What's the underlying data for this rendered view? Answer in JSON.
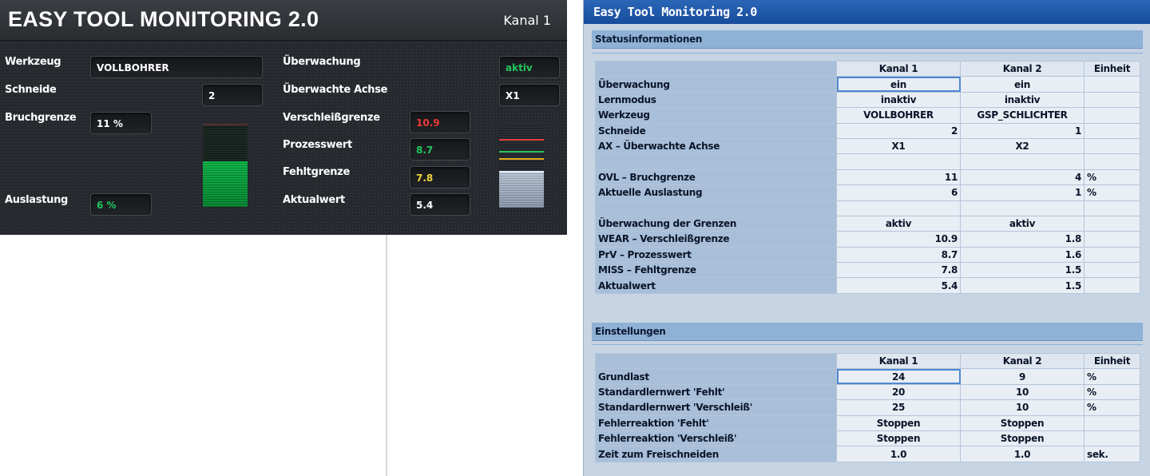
{
  "left_panel": {
    "title": "EASY TOOL MONITORING 2.0",
    "channel": "Kanal 1",
    "labels": {
      "werkzeug": "Werkzeug",
      "schneide": "Schneide",
      "bruchgrenze": "Bruchgrenze",
      "auslastung": "Auslastung",
      "ueberwachung": "Überwachung",
      "ueberwachte_achse": "Überwachte Achse",
      "verschleissgrenze": "Verschleißgrenze",
      "prozesswert": "Prozesswert",
      "fehltgrenze": "Fehltgrenze",
      "aktualwert": "Aktualwert"
    },
    "values": {
      "werkzeug": "VOLLBOHRER",
      "schneide": "2",
      "bruchgrenze": "11 %",
      "auslastung": "6 %",
      "ueberwachung": "aktiv",
      "ueberwachte_achse": "X1",
      "verschleissgrenze": "10.9",
      "prozesswert": "8.7",
      "fehltgrenze": "7.8",
      "aktualwert": "5.4"
    },
    "load_gauge": {
      "fill_fraction": 0.55,
      "color": "#0fb84a"
    },
    "limit_gauge": {
      "lines": [
        {
          "name": "verschleissgrenze",
          "color": "#e23a3a"
        },
        {
          "name": "prozesswert",
          "color": "#2fbf5a"
        },
        {
          "name": "fehltgrenze",
          "color": "#e2b020"
        },
        {
          "name": "aktualwert",
          "color": "#e6eef8"
        }
      ]
    },
    "colors": {
      "active": "#22c55e",
      "wear": "#f03a3a",
      "miss": "#f2d43a"
    }
  },
  "right_window": {
    "title": "Easy Tool Monitoring 2.0",
    "status_section": {
      "title": "Statusinformationen",
      "headers": [
        "",
        "Kanal 1",
        "Kanal 2",
        "Einheit"
      ],
      "rows": [
        [
          "Überwachung",
          "ein",
          "ein",
          ""
        ],
        [
          "Lernmodus",
          "inaktiv",
          "inaktiv",
          ""
        ],
        [
          "Werkzeug",
          "VOLLBOHRER",
          "GSP_SCHLICHTER",
          ""
        ],
        [
          "Schneide",
          "2",
          "1",
          ""
        ],
        [
          "AX – Überwachte Achse",
          "X1",
          "X2",
          ""
        ],
        [
          "",
          "",
          "",
          ""
        ],
        [
          "OVL – Bruchgrenze",
          "11",
          "4",
          "%"
        ],
        [
          "Aktuelle Auslastung",
          "6",
          "1",
          "%"
        ],
        [
          "",
          "",
          "",
          ""
        ],
        [
          "Überwachung der Grenzen",
          "aktiv",
          "aktiv",
          ""
        ],
        [
          "WEAR – Verschleißgrenze",
          "10.9",
          "1.8",
          ""
        ],
        [
          "PrV – Prozesswert",
          "8.7",
          "1.6",
          ""
        ],
        [
          "MISS – Fehltgrenze",
          "7.8",
          "1.5",
          ""
        ],
        [
          "Aktualwert",
          "5.4",
          "1.5",
          ""
        ]
      ]
    },
    "settings_section": {
      "title": "Einstellungen",
      "headers": [
        "",
        "Kanal 1",
        "Kanal 2",
        "Einheit"
      ],
      "rows": [
        [
          "Grundlast",
          "24",
          "9",
          "%"
        ],
        [
          "Standardlernwert 'Fehlt'",
          "20",
          "10",
          "%"
        ],
        [
          "Standardlernwert 'Verschleiß'",
          "25",
          "10",
          "%"
        ],
        [
          "Fehlerreaktion 'Fehlt'",
          "Stoppen",
          "Stoppen",
          ""
        ],
        [
          "Fehlerreaktion 'Verschleiß'",
          "Stoppen",
          "Stoppen",
          ""
        ],
        [
          "Zeit zum Freischneiden",
          "1.0",
          "1.0",
          "sek."
        ]
      ]
    }
  }
}
